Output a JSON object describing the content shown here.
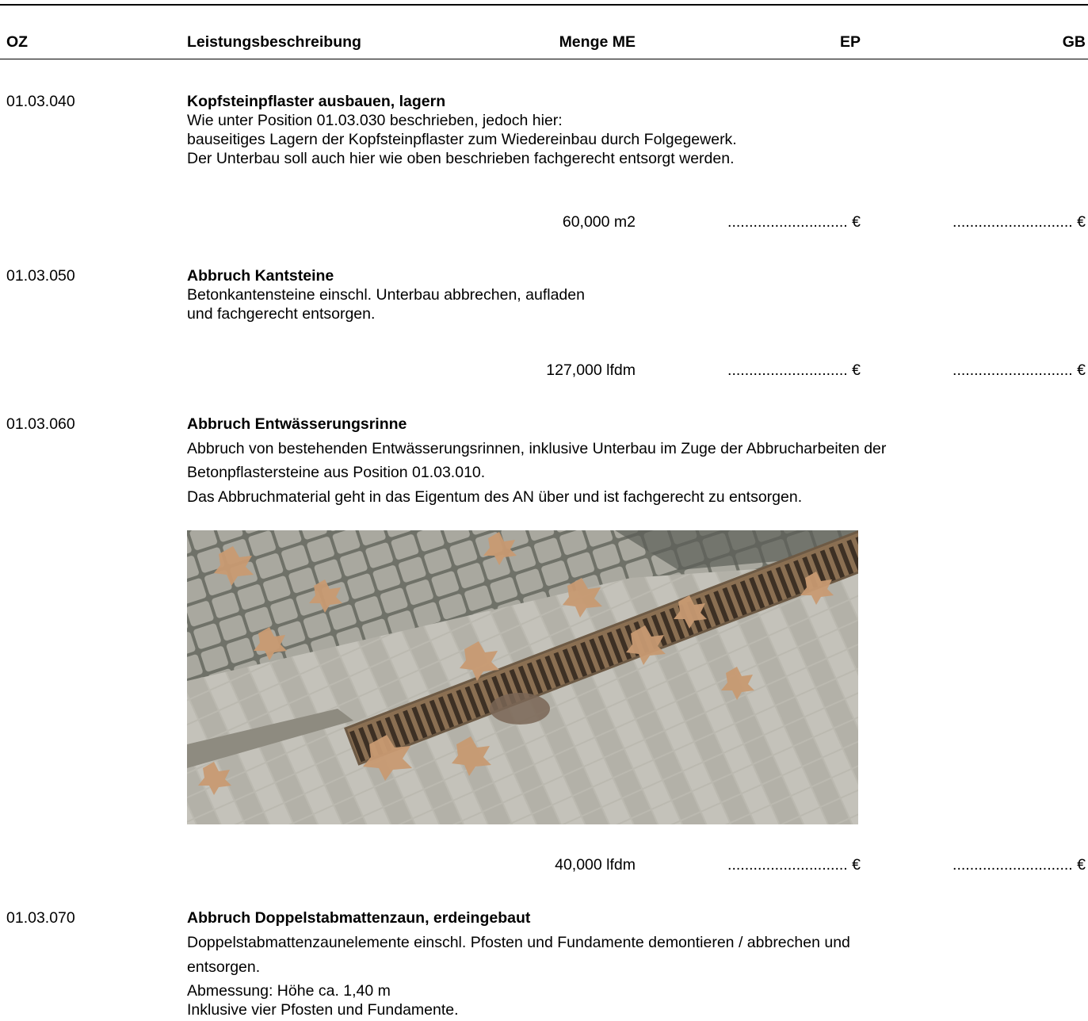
{
  "header": {
    "oz": "OZ",
    "description": "Leistungsbeschreibung",
    "quantity_unit": "Menge ME",
    "ep": "EP",
    "gb": "GB"
  },
  "positions": [
    {
      "oz": "01.03.040",
      "title": "Kopfsteinpflaster ausbauen, lagern",
      "lines": [
        "Wie unter Position 01.03.030 beschrieben, jedoch hier:",
        "bauseitiges Lagern der Kopfsteinpflaster zum Wiedereinbau durch Folgegewerk.",
        "Der Unterbau soll auch hier wie oben beschrieben fachgerecht entsorgt werden."
      ],
      "quantity": "60,000 m2",
      "ep": "............................ €",
      "gb": "............................ €"
    },
    {
      "oz": "01.03.050",
      "title": "Abbruch Kantsteine",
      "lines": [
        "Betonkantensteine einschl. Unterbau abbrechen, aufladen",
        "und fachgerecht entsorgen."
      ],
      "quantity": "127,000 lfdm",
      "ep": "............................ €",
      "gb": "............................ €"
    },
    {
      "oz": "01.03.060",
      "title": "Abbruch Entwässerungsrinne",
      "lines": [
        "Abbruch von bestehenden Entwässerungsrinnen, inklusive Unterbau im Zuge der Abbrucharbeiten der",
        "Betonpflastersteine aus Position 01.03.010.",
        "Das Abbruchmaterial geht in das Eigentum des AN über und ist fachgerecht zu entsorgen."
      ],
      "quantity": "40,000 lfdm",
      "ep": "............................ €",
      "gb": "............................ €"
    },
    {
      "oz": "01.03.070",
      "title": "Abbruch Doppelstabmattenzaun, erdeingebaut",
      "lines": [
        "Doppelstabmattenzaunelemente einschl. Pfosten und Fundamente demontieren / abbrechen und",
        "entsorgen.",
        "Abmessung: Höhe ca. 1,40 m",
        "Inklusive vier Pfosten und Fundamente."
      ]
    }
  ],
  "colors": {
    "paving": "#b9b7ae",
    "grate": "#8a6f52",
    "leaf": "#c89a72"
  }
}
